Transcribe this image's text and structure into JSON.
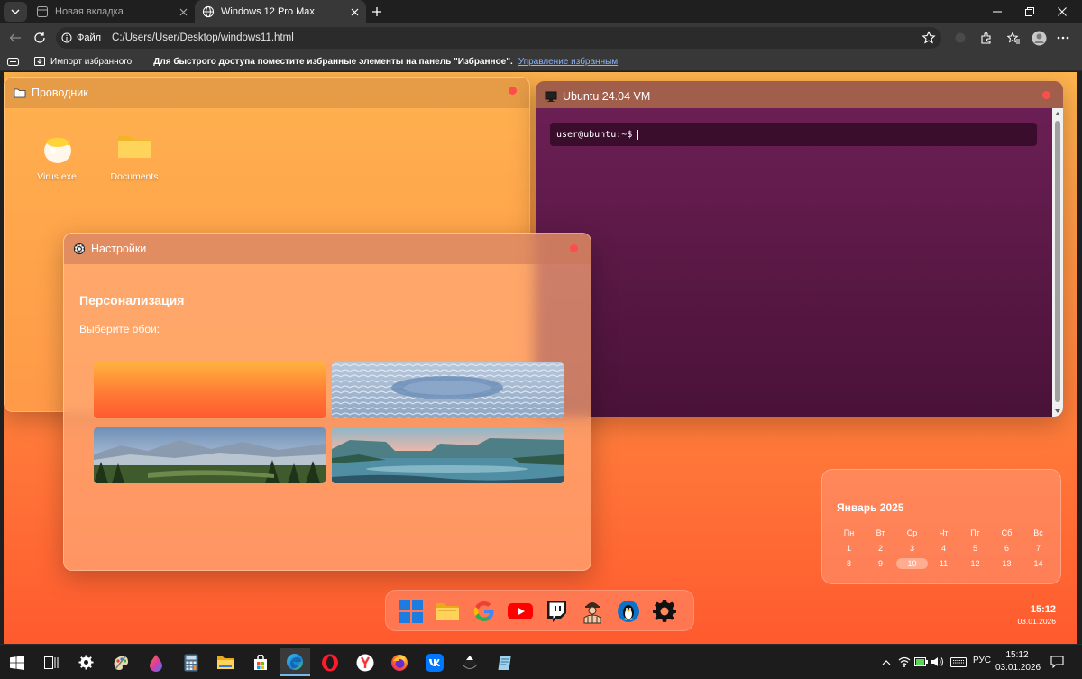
{
  "browser": {
    "tabs": [
      {
        "label": "Новая вкладка",
        "active": false
      },
      {
        "label": "Windows 12 Pro Max",
        "active": true
      }
    ],
    "address": {
      "site_label": "Файл",
      "url": "C:/Users/User/Desktop/windows11.html"
    },
    "favorites_bar": {
      "import_label": "Импорт избранного",
      "hint": "Для быстрого доступа поместите избранные элементы на панель \"Избранное\".",
      "manage_link": "Управление избранным"
    }
  },
  "explorer": {
    "title": "Проводник",
    "icons": [
      {
        "label": "Virus.exe",
        "icon": "egg-icon"
      },
      {
        "label": "Documents",
        "icon": "folder-icon"
      }
    ]
  },
  "ubuntu": {
    "title": "Ubuntu 24.04 VM",
    "prompt": "user@ubuntu:~$"
  },
  "settings": {
    "title": "Настройки",
    "heading": "Персонализация",
    "choose_label": "Выберите обои:",
    "wallpapers": [
      "orange-gradient",
      "blue-waves",
      "mountain-forest",
      "lake-sunset"
    ]
  },
  "calendar": {
    "month": "Январь 2025",
    "weekdays": [
      "Пн",
      "Вт",
      "Ср",
      "Чт",
      "Пт",
      "Сб",
      "Вс"
    ],
    "days": [
      "1",
      "2",
      "3",
      "4",
      "5",
      "6",
      "7",
      "8",
      "9",
      "10",
      "11",
      "12",
      "13",
      "14"
    ],
    "today": "10"
  },
  "dock": {
    "apps": [
      "windows-logo-icon",
      "folder-icon",
      "google-icon",
      "youtube-icon",
      "twitch-icon",
      "builder-icon",
      "linux-penguin-icon",
      "gear-icon"
    ]
  },
  "desktop_clock": {
    "time": "15:12",
    "date": "03.01.2026"
  },
  "taskbar": {
    "apps": [
      "windows-start-icon",
      "task-view-icon",
      "settings-gear-icon",
      "paint-icon",
      "drop-icon",
      "calculator-icon",
      "file-explorer-icon",
      "store-icon",
      "edge-icon",
      "opera-icon",
      "yandex-icon",
      "firefox-icon",
      "vk-icon",
      "inkscape-icon",
      "notepad-icon"
    ],
    "lang": "РУС",
    "time": "15:12",
    "date": "03.01.2026"
  },
  "colors": {
    "accent_orange": "#ff7d3b",
    "ubuntu_purple": "#5a1a44",
    "close_red": "#ff4d4d",
    "link_blue": "#8ab4f8"
  }
}
